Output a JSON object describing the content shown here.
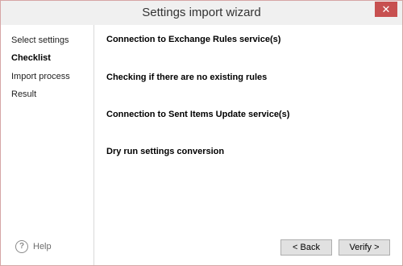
{
  "window": {
    "title": "Settings import wizard",
    "close_label": "✕"
  },
  "sidebar": {
    "items": [
      {
        "label": "Select settings",
        "active": false
      },
      {
        "label": "Checklist",
        "active": true
      },
      {
        "label": "Import process",
        "active": false
      },
      {
        "label": "Result",
        "active": false
      }
    ],
    "help_label": "Help",
    "help_icon": "question-circle-icon"
  },
  "checklist": {
    "items": [
      "Connection to Exchange Rules service(s)",
      "Checking if there are no existing rules",
      "Connection to Sent Items Update service(s)",
      "Dry run settings conversion"
    ]
  },
  "footer": {
    "back_label": "< Back",
    "verify_label": "Verify >"
  }
}
